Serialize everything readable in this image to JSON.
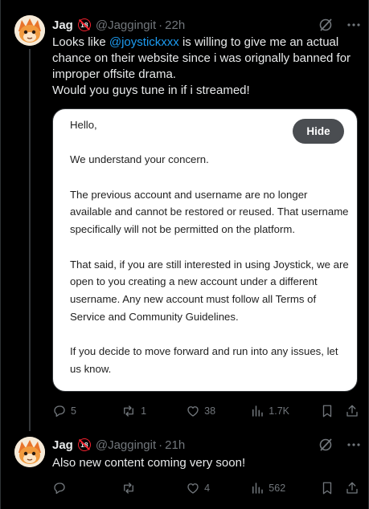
{
  "tweets": [
    {
      "name": "Jag",
      "badge": "18",
      "handle": "@Jaggingit",
      "time": "22h",
      "text_prefix": "Looks like ",
      "mention": "@joystickxxx",
      "text_suffix": " is willing to give me an actual chance on their website since i was orignally banned for improper offsite drama.",
      "text_line2": "Would you guys tune in if i streamed!",
      "image": {
        "hide_label": "Hide",
        "lines": [
          "Hello,",
          "",
          "We understand your concern.",
          "",
          "The previous account and username are no longer available and cannot be restored or reused. That username specifically will not be permitted on the platform.",
          "",
          "That said, if you are still interested in using Joystick, we are open to you creating a new account under a different username. Any new account must follow all Terms of Service and Community Guidelines.",
          "",
          "If you decide to move forward and run into any issues, let us know."
        ]
      },
      "stats": {
        "replies": "5",
        "reposts": "1",
        "likes": "38",
        "views": "1.7K"
      }
    },
    {
      "name": "Jag",
      "badge": "18",
      "handle": "@Jaggingit",
      "time": "21h",
      "text": "Also new content coming very soon!",
      "stats": {
        "replies": "",
        "reposts": "",
        "likes": "4",
        "views": "562"
      }
    }
  ],
  "colors": {
    "background": "#000000",
    "text": "#e7e9ea",
    "muted": "#71767b",
    "link": "#1d9bf0",
    "badge_ring": "#f4212e",
    "border": "#2f3336"
  },
  "icons": [
    "grok-icon",
    "more-icon",
    "reply-icon",
    "repost-icon",
    "like-icon",
    "views-icon",
    "bookmark-icon",
    "share-icon",
    "adult-18-badge-icon"
  ]
}
